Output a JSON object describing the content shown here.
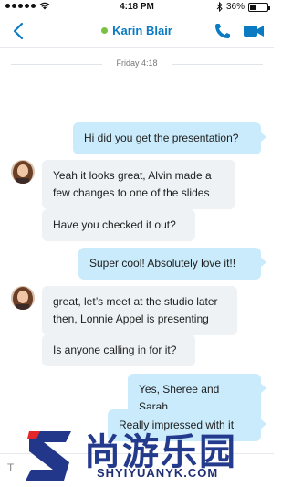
{
  "status_bar": {
    "time": "4:18 PM",
    "battery": "36%",
    "battery_level": 0.36
  },
  "header": {
    "contact_name": "Karin Blair",
    "presence_color": "#7ac143"
  },
  "divider": {
    "label": "Friday 4:18"
  },
  "messages": [
    {
      "direction": "out",
      "text": "Hi did you get the presentation?"
    },
    {
      "direction": "in",
      "text": "Yeah it looks great, Alvin made a few changes to one of the slides"
    },
    {
      "direction": "in",
      "text": "Have you checked it out?"
    },
    {
      "direction": "out",
      "text": "Super cool! Absolutely love it!!"
    },
    {
      "direction": "in",
      "text": "great, let’s meet at the studio later then, Lonnie Appel is presenting"
    },
    {
      "direction": "in",
      "text": "Is anyone calling in for it?"
    },
    {
      "direction": "out",
      "text": "Yes, Sheree and Sarah"
    },
    {
      "direction": "out",
      "text": "Really impressed with it"
    }
  ],
  "compose": {
    "text": "T"
  },
  "watermark": {
    "cn": "尚游乐园",
    "en": "SHYIYUANYK.COM"
  },
  "colors": {
    "accent": "#0a7bc2",
    "outgoing_bubble": "#c9ebfb",
    "incoming_bubble": "#eef2f5"
  }
}
